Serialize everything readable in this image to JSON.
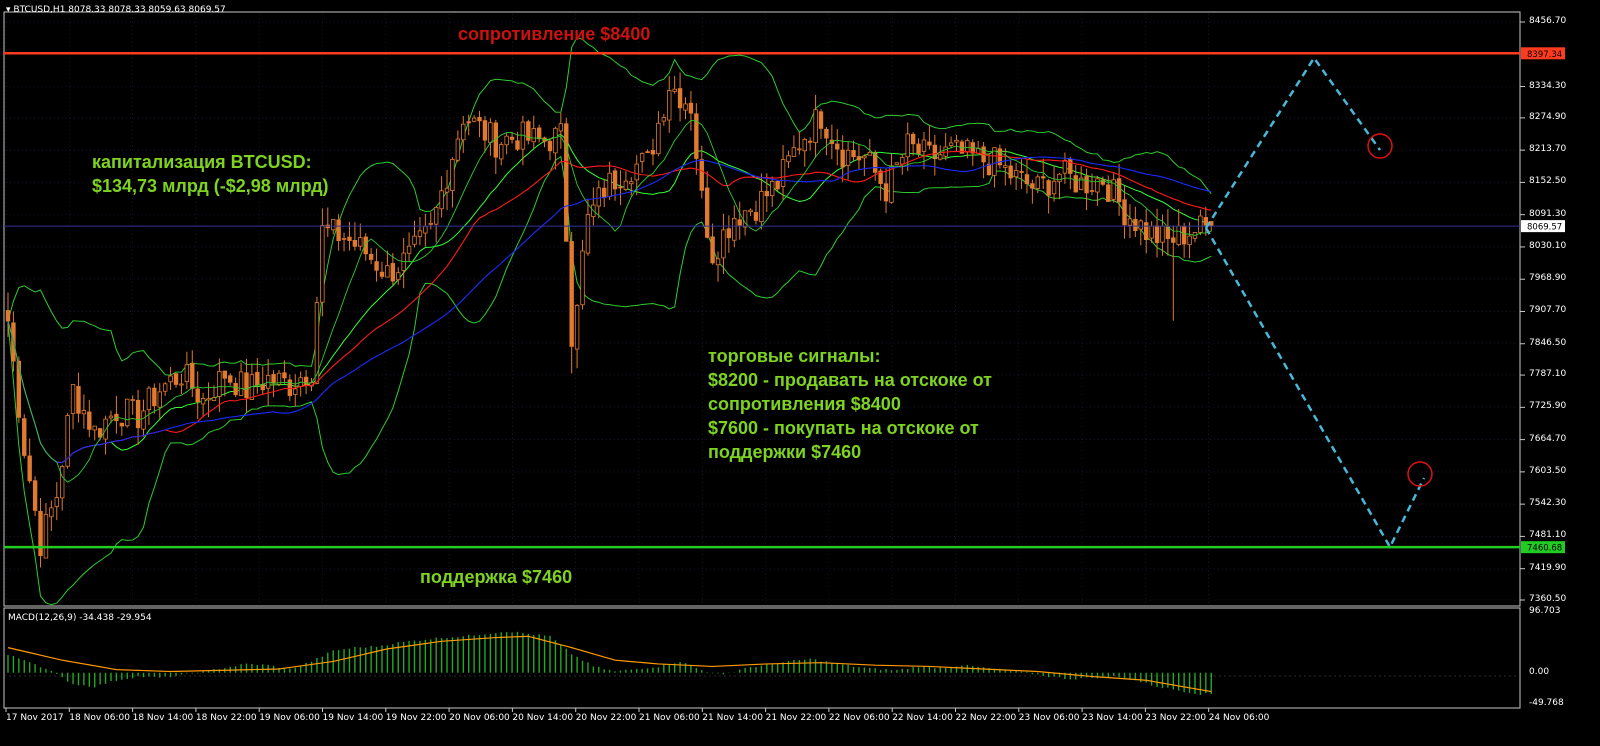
{
  "header": {
    "symbol_line": "BTCUSD,H1  8078.33 8078.33 8059.63 8069.57"
  },
  "macd_header": "MACD(12,26,9) -34.438 -29.954",
  "annotations": {
    "resistance_label": "сопротивление $8400",
    "support_label": "поддержка $7460",
    "cap_line1": "капитализация BTCUSD:",
    "cap_line2": "$134,73 млрд (-$2,98 млрд)",
    "signals_line1": "торговые сигналы:",
    "signals_line2": "$8200 - продавать на отскоке от",
    "signals_line3": "сопротивления $8400",
    "signals_line4": "$7600 - покупать на отскоке от",
    "signals_line5": "поддержки $7460"
  },
  "colors": {
    "background": "#000000",
    "resistance": "#ff3b1f",
    "support": "#22cc22",
    "bull_candle": "#e07a2e",
    "bear_candle": "#e07a2e",
    "bollinger": "#2ecc2e",
    "ma_fast": "#ff1a1a",
    "ma_slow": "#1a2bff",
    "ma_signal": "#33ff33",
    "forecast": "#49b8d8",
    "macd_hist": "#22aa22",
    "macd_signal": "#ff9900"
  },
  "chart_data": [
    {
      "type": "candlestick",
      "symbol": "BTCUSD",
      "timeframe": "H1",
      "ohlc_current": {
        "open": 8078.33,
        "high": 8078.33,
        "low": 8059.63,
        "close": 8069.57
      },
      "ylim": [
        7360.5,
        8456.7
      ],
      "y_ticks": [
        "8456.70",
        "8334.30",
        "8274.90",
        "8213.70",
        "8152.50",
        "8091.30",
        "8030.10",
        "7968.90",
        "7907.70",
        "7846.50",
        "7787.10",
        "7725.90",
        "7664.70",
        "7603.50",
        "7542.30",
        "7481.10",
        "7419.90",
        "7360.50"
      ],
      "price_tags": [
        {
          "label": "8397.34",
          "value": 8397.34,
          "role": "resistance"
        },
        {
          "label": "8069.57",
          "value": 8069.57,
          "role": "current"
        },
        {
          "label": "7460.68",
          "value": 7460.68,
          "role": "support"
        }
      ],
      "x_ticks": [
        "17 Nov 2017",
        "18 Nov 06:00",
        "18 Nov 14:00",
        "18 Nov 22:00",
        "19 Nov 06:00",
        "19 Nov 14:00",
        "19 Nov 22:00",
        "20 Nov 06:00",
        "20 Nov 14:00",
        "20 Nov 22:00",
        "21 Nov 06:00",
        "21 Nov 14:00",
        "21 Nov 22:00",
        "22 Nov 06:00",
        "22 Nov 14:00",
        "22 Nov 22:00",
        "23 Nov 06:00",
        "23 Nov 14:00",
        "23 Nov 22:00",
        "24 Nov 06:00"
      ],
      "levels": {
        "resistance": 8400,
        "support": 7460
      },
      "close_anchors": [
        [
          0,
          7890
        ],
        [
          3,
          7650
        ],
        [
          6,
          7470
        ],
        [
          9,
          7560
        ],
        [
          12,
          7760
        ],
        [
          16,
          7680
        ],
        [
          20,
          7720
        ],
        [
          24,
          7710
        ],
        [
          28,
          7760
        ],
        [
          32,
          7790
        ],
        [
          36,
          7740
        ],
        [
          40,
          7790
        ],
        [
          44,
          7760
        ],
        [
          48,
          7780
        ],
        [
          52,
          7770
        ],
        [
          56,
          7800
        ],
        [
          58,
          8060
        ],
        [
          62,
          8050
        ],
        [
          66,
          8020
        ],
        [
          70,
          7980
        ],
        [
          74,
          8010
        ],
        [
          78,
          8060
        ],
        [
          84,
          8280
        ],
        [
          90,
          8230
        ],
        [
          94,
          8240
        ],
        [
          98,
          8230
        ],
        [
          102,
          8240
        ],
        [
          104,
          7870
        ],
        [
          107,
          8080
        ],
        [
          110,
          8140
        ],
        [
          114,
          8180
        ],
        [
          118,
          8190
        ],
        [
          122,
          8340
        ],
        [
          126,
          8300
        ],
        [
          128,
          8120
        ],
        [
          130,
          8020
        ],
        [
          134,
          8090
        ],
        [
          138,
          8110
        ],
        [
          142,
          8150
        ],
        [
          146,
          8230
        ],
        [
          150,
          8280
        ],
        [
          154,
          8210
        ],
        [
          158,
          8200
        ],
        [
          162,
          8140
        ],
        [
          166,
          8220
        ],
        [
          170,
          8200
        ],
        [
          174,
          8210
        ],
        [
          178,
          8200
        ],
        [
          182,
          8190
        ],
        [
          186,
          8160
        ],
        [
          190,
          8140
        ],
        [
          194,
          8170
        ],
        [
          198,
          8150
        ],
        [
          202,
          8160
        ],
        [
          206,
          8100
        ],
        [
          210,
          8060
        ],
        [
          214,
          8040
        ],
        [
          218,
          8060
        ],
        [
          222,
          8070
        ]
      ]
    },
    {
      "type": "histogram+line",
      "name": "MACD(12,26,9)",
      "main": -34.438,
      "signal": -29.954,
      "ylim": [
        -49.768,
        96.703
      ],
      "y_ticks": [
        "96.703",
        "0.00",
        "-49.768"
      ],
      "hist_anchors": [
        [
          0,
          28
        ],
        [
          4,
          18
        ],
        [
          8,
          2
        ],
        [
          12,
          -18
        ],
        [
          16,
          -22
        ],
        [
          20,
          -12
        ],
        [
          24,
          -6
        ],
        [
          28,
          -8
        ],
        [
          32,
          -4
        ],
        [
          36,
          2
        ],
        [
          40,
          8
        ],
        [
          44,
          14
        ],
        [
          48,
          12
        ],
        [
          52,
          6
        ],
        [
          56,
          18
        ],
        [
          60,
          35
        ],
        [
          64,
          40
        ],
        [
          68,
          42
        ],
        [
          72,
          48
        ],
        [
          76,
          52
        ],
        [
          80,
          56
        ],
        [
          84,
          58
        ],
        [
          88,
          62
        ],
        [
          92,
          66
        ],
        [
          96,
          62
        ],
        [
          100,
          58
        ],
        [
          104,
          30
        ],
        [
          108,
          10
        ],
        [
          112,
          2
        ],
        [
          116,
          6
        ],
        [
          120,
          10
        ],
        [
          124,
          18
        ],
        [
          128,
          4
        ],
        [
          132,
          -4
        ],
        [
          136,
          8
        ],
        [
          140,
          12
        ],
        [
          144,
          18
        ],
        [
          148,
          22
        ],
        [
          152,
          16
        ],
        [
          156,
          10
        ],
        [
          160,
          6
        ],
        [
          164,
          4
        ],
        [
          168,
          10
        ],
        [
          172,
          8
        ],
        [
          176,
          12
        ],
        [
          180,
          8
        ],
        [
          184,
          4
        ],
        [
          188,
          0
        ],
        [
          192,
          -6
        ],
        [
          196,
          -10
        ],
        [
          200,
          -8
        ],
        [
          204,
          -6
        ],
        [
          208,
          -12
        ],
        [
          212,
          -22
        ],
        [
          216,
          -28
        ],
        [
          220,
          -34
        ],
        [
          222,
          -34
        ]
      ],
      "signal_anchors": [
        [
          0,
          40
        ],
        [
          10,
          20
        ],
        [
          20,
          5
        ],
        [
          30,
          2
        ],
        [
          40,
          4
        ],
        [
          50,
          6
        ],
        [
          60,
          18
        ],
        [
          70,
          38
        ],
        [
          80,
          50
        ],
        [
          90,
          56
        ],
        [
          96,
          58
        ],
        [
          104,
          40
        ],
        [
          112,
          20
        ],
        [
          120,
          14
        ],
        [
          130,
          10
        ],
        [
          140,
          14
        ],
        [
          150,
          16
        ],
        [
          160,
          12
        ],
        [
          170,
          10
        ],
        [
          180,
          6
        ],
        [
          190,
          2
        ],
        [
          200,
          -6
        ],
        [
          210,
          -12
        ],
        [
          222,
          -30
        ]
      ]
    }
  ]
}
